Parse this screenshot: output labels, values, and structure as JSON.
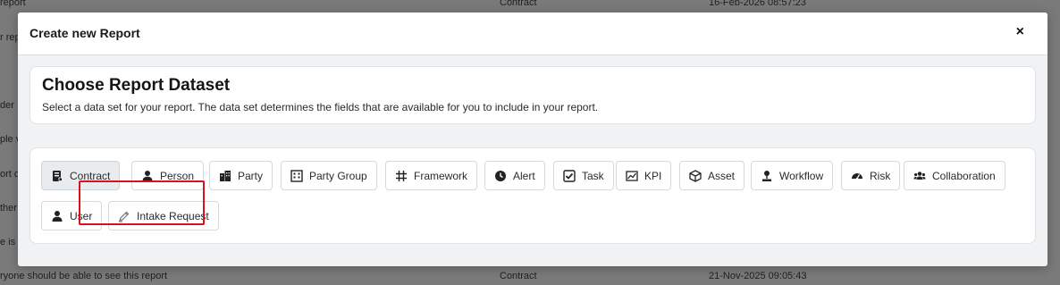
{
  "background": {
    "rows": [
      {
        "left": "report",
        "type": "Contract",
        "date": "16-Feb-2026 08:57:23"
      },
      {
        "left": "r rep"
      },
      {
        "left": "der"
      },
      {
        "left": "ple v"
      },
      {
        "left": "ort o"
      },
      {
        "left": "ther"
      },
      {
        "left": "e is a"
      },
      {
        "left": "ryone should be able to see this report",
        "type": "Contract",
        "date": "21-Nov-2025 09:05:43"
      }
    ]
  },
  "modal": {
    "title": "Create new Report",
    "close_label": "×",
    "heading": "Choose Report Dataset",
    "description": "Select a data set for your report. The data set determines the fields that are available for you to include in your report.",
    "datasets": [
      {
        "label": "Contract",
        "icon": "contract-icon",
        "selected": true
      },
      {
        "label": "Person",
        "icon": "person-icon"
      },
      {
        "label": "Party",
        "icon": "building-icon"
      },
      {
        "label": "Party Group",
        "icon": "building-group-icon"
      },
      {
        "label": "Framework",
        "icon": "hashtag-icon"
      },
      {
        "label": "Alert",
        "icon": "clock-icon"
      },
      {
        "label": "Task",
        "icon": "checkbox-icon"
      },
      {
        "label": "KPI",
        "icon": "chart-icon"
      },
      {
        "label": "Asset",
        "icon": "box-icon"
      },
      {
        "label": "Workflow",
        "icon": "workflow-icon"
      },
      {
        "label": "Risk",
        "icon": "gauge-icon"
      },
      {
        "label": "Collaboration",
        "icon": "users-icon"
      },
      {
        "label": "User",
        "icon": "user-icon"
      },
      {
        "label": "Intake Request",
        "icon": "pen-icon",
        "highlighted": true
      }
    ]
  },
  "colors": {
    "highlight": "#d8111b",
    "selected_bg": "#e9ecef"
  }
}
